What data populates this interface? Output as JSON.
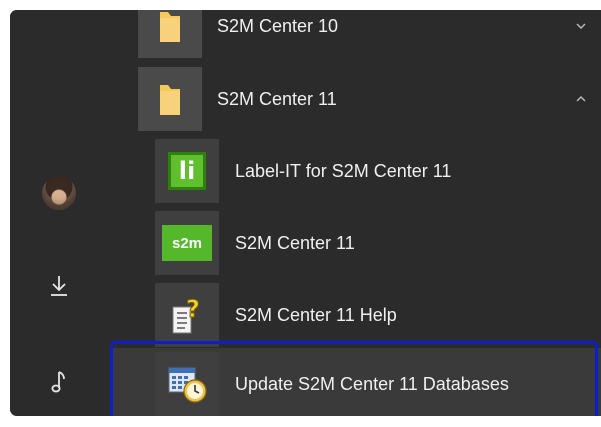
{
  "start_menu": {
    "rail": {
      "user_avatar": "avatar",
      "downloads_icon": "download-icon",
      "music_icon": "music-note-icon"
    },
    "items": [
      {
        "type": "group",
        "label": "S2M Center 10",
        "icon": "folder-icon",
        "expanded": false
      },
      {
        "type": "group",
        "label": "S2M Center 11",
        "icon": "folder-icon",
        "expanded": true
      },
      {
        "type": "app",
        "label": "Label-IT for S2M Center 11",
        "icon": "label-it-icon",
        "icon_text": "li"
      },
      {
        "type": "app",
        "label": "S2M Center 11",
        "icon": "s2m-icon",
        "icon_text": "s2m"
      },
      {
        "type": "app",
        "label": "S2M Center 11 Help",
        "icon": "help-document-icon"
      },
      {
        "type": "app",
        "label": "Update S2M Center 11 Databases",
        "icon": "scheduler-icon",
        "selected": true
      }
    ],
    "colors": {
      "background": "#2b2b2b",
      "focus_ring": "#0b1fd1",
      "app_green": "#5fbf2c"
    }
  }
}
